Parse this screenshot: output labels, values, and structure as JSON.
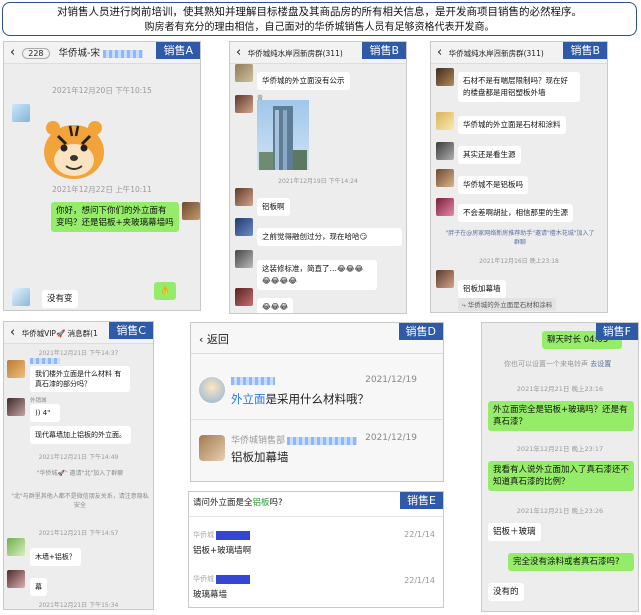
{
  "header": {
    "line1": "对销售人员进行岗前培训，使其熟知并理解目标楼盘及其商品房的所有相关信息，是开发商项目销售的必然程序。",
    "line2": "购房者有充分的理由相信，自己面对的华侨城销售人员有足够资格代表开发商。"
  },
  "panel_a": {
    "tag": "销售A",
    "badge": "228",
    "title": "华侨城-宋",
    "ts1": "2021年12月20日 下午10:15",
    "ts2": "2021年12月22日 上午10:11",
    "msg_question": "你好，想问下你们的外立面有变吗？还是铝板+夹玻璃幕墙吗",
    "msg_reply": "没有变",
    "emoji": "👌"
  },
  "panel_b1": {
    "tag": "销售B",
    "title": "华侨城纯水岸🈷新房群(311)",
    "msg1": "华侨城的外立面没有公示",
    "sender": "黄",
    "ts": "2021年12月19日 下午14:24",
    "msg2": "铝板啊",
    "msg3": "之前觉得融创过分，现在哈哈😏",
    "msg4": "这装修标准，简直了…😂😂😂😂😂😂😂",
    "msg5": "😂😂😂"
  },
  "panel_b2": {
    "tag": "销售B",
    "title": "华侨城纯水岸🈷新房群(311)",
    "msg1": "石材不是有喘层限制吗？现在好的楼盘都是用铝塑板外墙",
    "msg2": "华侨城的外立面是石材和涂料",
    "msg3": "其实还是看生源",
    "msg4": "华侨城不是铝板吗",
    "msg5": "不会差啊胡扯，相信那里的生源",
    "notice": "\"胖子在@房家网络新房推荐助手\"邀请\"檀木花城\"加入了群聊",
    "ts": "2021年12月16日 晚上23:18",
    "msg6": "铝板加幕墙",
    "quote": "华侨城的外立面是石材和涂料"
  },
  "panel_c": {
    "tag": "销售C",
    "title": "华侨城VIP🚀 消息群(1",
    "ts1": "2021年12月21日 下午14:37",
    "msg1": "我们楼外立面是什么材料 有真石漆的部分吗？",
    "sender": "外销城",
    "voice": "4\"",
    "msg2": "现代幕墙加上铝板的外立面。",
    "ts2": "2021年12月21日 下午14:49",
    "notice1": "\"华侨城🚀\" 邀请\"北\"加入了群聊",
    "notice2": "\"北\"与群里其他人都不是微信朋友关系，请注意隐私安全",
    "ts3": "2021年12月21日 下午14:57",
    "msg3": "木墙+铝板？",
    "msg4": "幕",
    "ts4": "2021年12月21日 下午15:34"
  },
  "panel_d": {
    "tag": "销售D",
    "back": "返回",
    "date1": "2021/12/19",
    "question_hl": "外立面",
    "question_rest": "是采用什么材料哦？",
    "sender2": "华侨城销售部",
    "date2": "2021/12/19",
    "answer": "铝板加幕墙"
  },
  "panel_e": {
    "tag": "销售E",
    "question_pre": "请问外立面是全",
    "question_hl": "铝板",
    "question_post": "吗?",
    "sender": "华侨城",
    "date1": "22/1/14",
    "answer1": "铝板+玻璃墙啊",
    "date2": "22/1/14",
    "answer2": "玻璃幕墙"
  },
  "panel_f": {
    "tag": "销售F",
    "header_msg": "聊天时长 04:03",
    "notice": "你也可以设置一个来电铃声",
    "notice_link": "去设置",
    "ts1": "2021年12月21日 晚上23:16",
    "msg1": "外立面完全是铝板+玻璃吗？还是有真石漆？",
    "ts2": "2021年12月21日 晚上23:17",
    "msg2": "我看有人说外立面加入了真石漆还不知道真石漆的比例？",
    "ts3": "2021年12月21日 晚上23:26",
    "msg3": "铝板＋玻璃",
    "msg4": "完全没有涂料或者真石漆吗?",
    "msg5": "没有的"
  }
}
